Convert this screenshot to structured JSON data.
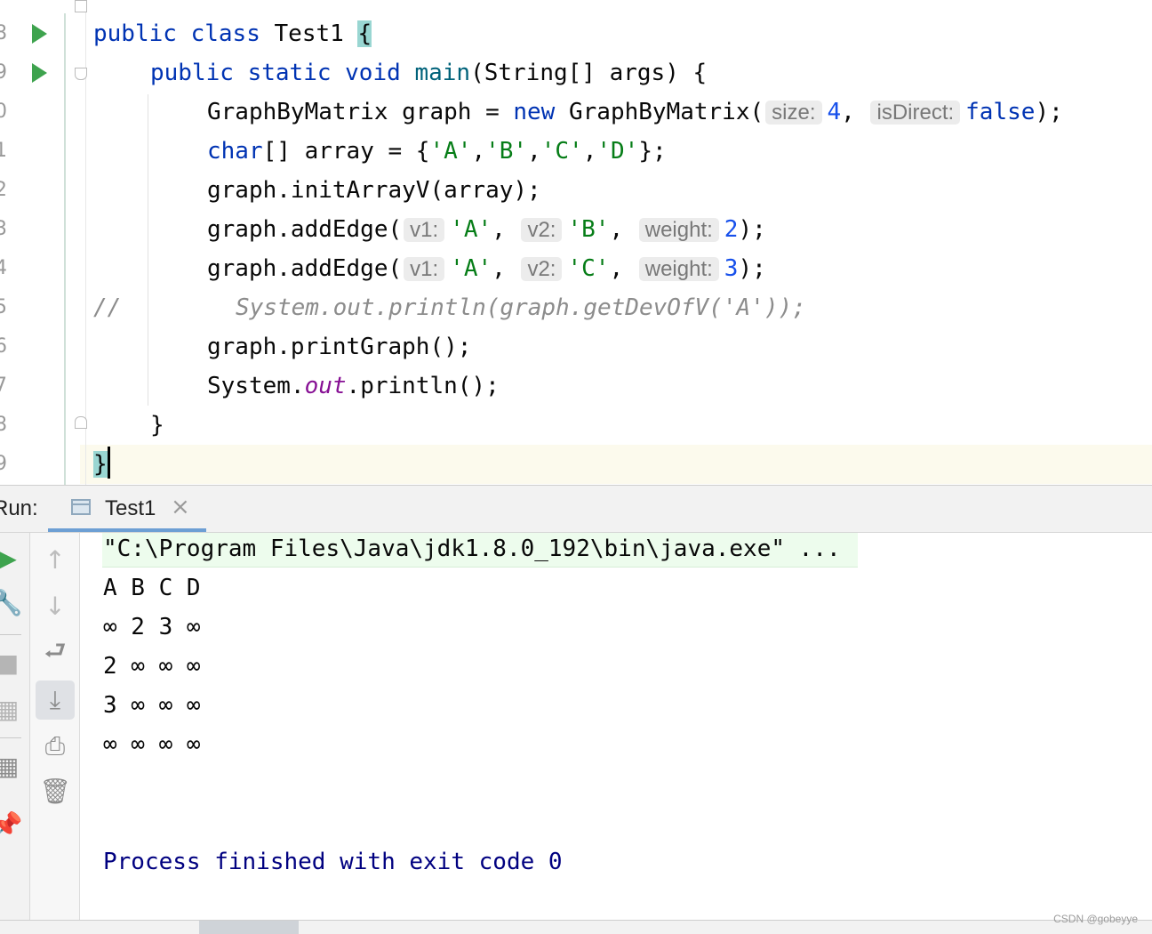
{
  "editor": {
    "gutter_numbers": [
      "8",
      "9",
      "0",
      "1",
      "2",
      "3",
      "4",
      "5",
      "6",
      "7",
      "8",
      "9"
    ],
    "code": {
      "l1": {
        "kw1": "public",
        "kw2": "class",
        "name": "Test1",
        "brace": "{"
      },
      "l2": {
        "kw1": "public",
        "kw2": "static",
        "kw3": "void",
        "fn": "main",
        "rest": "(String[] args) {"
      },
      "l3": {
        "pre": "GraphByMatrix graph = ",
        "kw": "new",
        "ctor": " GraphByMatrix(",
        "hint1": "size:",
        "val1": "4",
        "sep": ", ",
        "hint2": "isDirect:",
        "val2": "false",
        "end": ");"
      },
      "l4": {
        "kw": "char",
        "mid": "[] array = {",
        "s1": "'A'",
        "c1": ",",
        "s2": "'B'",
        "c2": ",",
        "s3": "'C'",
        "c3": ",",
        "s4": "'D'",
        "end": "};"
      },
      "l5": "graph.initArrayV(array);",
      "l6": {
        "pre": "graph.addEdge(",
        "h1": "v1:",
        "a1": "'A'",
        "c1": ", ",
        "h2": "v2:",
        "a2": "'B'",
        "c2": ", ",
        "h3": "weight:",
        "a3": "2",
        "end": ");"
      },
      "l7": {
        "pre": "graph.addEdge(",
        "h1": "v1:",
        "a1": "'A'",
        "c1": ", ",
        "h2": "v2:",
        "a2": "'C'",
        "c2": ", ",
        "h3": "weight:",
        "a3": "3",
        "end": ");"
      },
      "l8": {
        "slashes": "//",
        "comment": "System.out.println(graph.getDevOfV('A'));"
      },
      "l9": "graph.printGraph();",
      "l10": {
        "pre": "System.",
        "field": "out",
        "post": ".println();"
      },
      "l11": "}",
      "l12": "}"
    }
  },
  "run": {
    "label": "Run:",
    "tab_label": "Test1",
    "close_glyph": "×"
  },
  "console": {
    "command": "\"C:\\Program Files\\Java\\jdk1.8.0_192\\bin\\java.exe\" ...",
    "lines": [
      "A B C D",
      "∞ 2 3 ∞",
      "2 ∞ ∞ ∞",
      "3 ∞ ∞ ∞",
      "∞ ∞ ∞ ∞"
    ],
    "exit": "Process finished with exit code 0"
  },
  "watermark": "CSDN @gobeyye",
  "icons": {
    "up": "↑",
    "down": "↓",
    "wrap": "⮐",
    "scroll": "⤓",
    "print": "⎙",
    "trash": "🗑",
    "rerun": "▶",
    "wrench": "🔧",
    "stop": "■",
    "layout": "▦",
    "pin": "📌"
  }
}
